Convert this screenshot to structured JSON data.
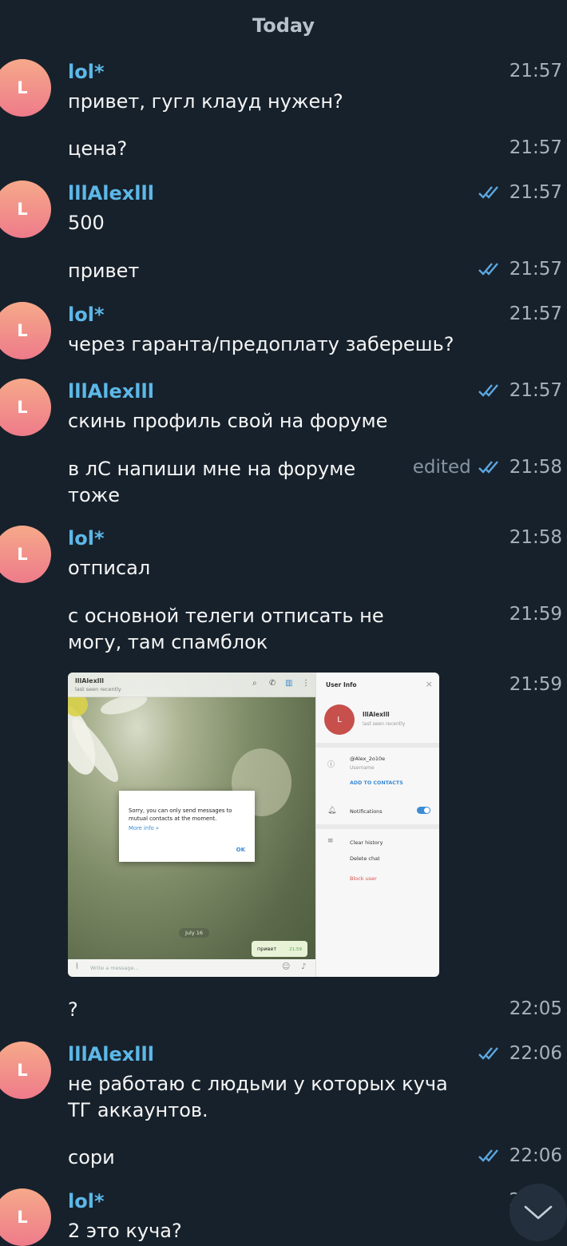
{
  "date_header": "Today",
  "messages": [
    {
      "sender": "lol*",
      "avatar": "L",
      "text": "привет, гугл клауд нужен?",
      "time": "21:57"
    },
    {
      "text": "цена?",
      "time": "21:57"
    },
    {
      "sender": "lllAlexlll",
      "avatar": "L",
      "text": "500",
      "time": "21:57",
      "read": true
    },
    {
      "text": "привет",
      "time": "21:57",
      "read": true
    },
    {
      "sender": "lol*",
      "avatar": "L",
      "text": "через гаранта/предоплату заберешь?",
      "time": "21:57"
    },
    {
      "sender": "lllAlexlll",
      "avatar": "L",
      "text": "скинь профиль свой на форуме",
      "time": "21:57",
      "read": true
    },
    {
      "text_lines": [
        "в лС напиши мне на форуме",
        "тоже"
      ],
      "time": "21:58",
      "edited": "edited",
      "read": true
    },
    {
      "sender": "lol*",
      "avatar": "L",
      "text": "отписал",
      "time": "21:58"
    },
    {
      "text_lines": [
        "с основной телеги отписать не",
        "могу, там спамблок"
      ],
      "time": "21:59"
    },
    {
      "image": true,
      "time": "21:59"
    },
    {
      "text": "?",
      "time": "22:05"
    },
    {
      "sender": "lllAlexlll",
      "avatar": "L",
      "text_lines": [
        "не работаю с людьми у которых куча",
        "ТГ аккаунтов."
      ],
      "time": "22:06",
      "read": true
    },
    {
      "text": "сори",
      "time": "22:06",
      "read": true
    },
    {
      "sender": "lol*",
      "avatar": "L",
      "text": "2 это куча?",
      "time": "2"
    }
  ],
  "screenshot": {
    "chat_name": "lllAlexlll",
    "chat_status": "last seen recently",
    "dialog_text": "Sorry, you can only send messages to mutual contacts at the moment.",
    "dialog_link": "More info »",
    "dialog_ok": "OK",
    "day_label": "July 16",
    "out_message": "привет",
    "out_time": "21:59",
    "input_placeholder": "Write a message...",
    "panel_title": "User Info",
    "panel_avatar": "L",
    "panel_name": "lllAlexlll",
    "panel_status": "last seen recently",
    "panel_username": "@Alex_2o10e",
    "panel_username_label": "Username",
    "panel_add_contact": "ADD TO CONTACTS",
    "panel_notifications": "Notifications",
    "panel_clear_history": "Clear history",
    "panel_delete_chat": "Delete chat",
    "panel_block_user": "Block user"
  },
  "colors": {
    "background": "#17212b",
    "sender": "#5cb8e8",
    "ticks": "#5ca7e0",
    "time": "#a9b2bc"
  },
  "icons": {
    "read_ticks": "double-check-icon",
    "scroll_down": "chevron-down-icon"
  }
}
